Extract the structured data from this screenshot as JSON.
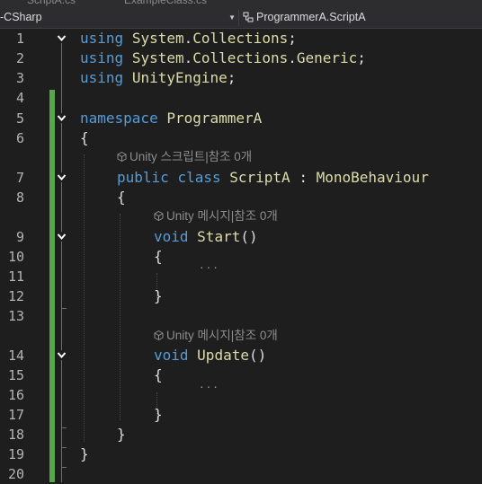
{
  "tabs": [
    {
      "label": "ScriptA.cs"
    },
    {
      "label": "ExampleClass.cs"
    }
  ],
  "nav": {
    "project": "-CSharp",
    "member": "ProgrammerA.ScriptA"
  },
  "colors": {
    "background": "#1e1e1e",
    "keyword": "#569cd6",
    "identifier": "#dcdcaa",
    "change_bar": "#57a64a"
  },
  "code_lens": {
    "class_refs": "Unity 스크립트|참조 0개",
    "start_refs": "Unity 메시지|참조 0개",
    "update_refs": "Unity 메시지|참조 0개"
  },
  "lines": [
    {
      "n": "1",
      "tokens": [
        [
          "kw",
          "using"
        ],
        [
          "plain",
          " "
        ],
        [
          "ns",
          "System"
        ],
        [
          "plain",
          "."
        ],
        [
          "ns",
          "Collections"
        ],
        [
          "plain",
          ";"
        ]
      ]
    },
    {
      "n": "2",
      "tokens": [
        [
          "kw",
          "using"
        ],
        [
          "plain",
          " "
        ],
        [
          "ns",
          "System"
        ],
        [
          "plain",
          "."
        ],
        [
          "ns",
          "Collections"
        ],
        [
          "plain",
          "."
        ],
        [
          "ns",
          "Generic"
        ],
        [
          "plain",
          ";"
        ]
      ]
    },
    {
      "n": "3",
      "tokens": [
        [
          "kw",
          "using"
        ],
        [
          "plain",
          " "
        ],
        [
          "ns",
          "UnityEngine"
        ],
        [
          "plain",
          ";"
        ]
      ]
    },
    {
      "n": "4",
      "tokens": []
    },
    {
      "n": "5",
      "tokens": [
        [
          "kw",
          "namespace"
        ],
        [
          "plain",
          " "
        ],
        [
          "ns",
          "ProgrammerA"
        ]
      ]
    },
    {
      "n": "6",
      "tokens": [
        [
          "plain",
          "{"
        ]
      ]
    },
    {
      "n": "7",
      "tokens": [
        [
          "kw",
          "public"
        ],
        [
          "plain",
          " "
        ],
        [
          "kw",
          "class"
        ],
        [
          "plain",
          " "
        ],
        [
          "ty",
          "ScriptA"
        ],
        [
          "plain",
          " : "
        ],
        [
          "ty",
          "MonoBehaviour"
        ]
      ]
    },
    {
      "n": "8",
      "tokens": [
        [
          "plain",
          "{"
        ]
      ]
    },
    {
      "n": "9",
      "tokens": [
        [
          "kw",
          "void"
        ],
        [
          "plain",
          " "
        ],
        [
          "fn",
          "Start"
        ],
        [
          "plain",
          "()"
        ]
      ]
    },
    {
      "n": "10",
      "tokens": [
        [
          "plain",
          "{"
        ]
      ]
    },
    {
      "n": "11",
      "tokens": []
    },
    {
      "n": "12",
      "tokens": [
        [
          "plain",
          "}"
        ]
      ]
    },
    {
      "n": "13",
      "tokens": []
    },
    {
      "n": "14",
      "tokens": [
        [
          "kw",
          "void"
        ],
        [
          "plain",
          " "
        ],
        [
          "fn",
          "Update"
        ],
        [
          "plain",
          "()"
        ]
      ]
    },
    {
      "n": "15",
      "tokens": [
        [
          "plain",
          "{"
        ]
      ]
    },
    {
      "n": "16",
      "tokens": []
    },
    {
      "n": "17",
      "tokens": [
        [
          "plain",
          "}"
        ]
      ]
    },
    {
      "n": "18",
      "tokens": [
        [
          "plain",
          "}"
        ]
      ]
    },
    {
      "n": "19",
      "tokens": [
        [
          "plain",
          "}"
        ]
      ]
    },
    {
      "n": "20",
      "tokens": []
    }
  ]
}
